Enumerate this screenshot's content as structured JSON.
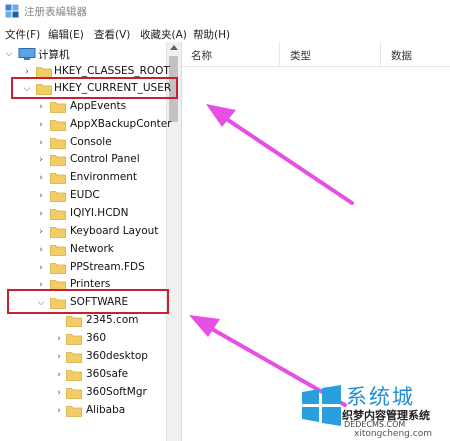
{
  "window": {
    "title": "注册表编辑器"
  },
  "menu": [
    "文件(F)",
    "编辑(E)",
    "查看(V)",
    "收藏夹(A)",
    "帮助(H)"
  ],
  "tree": {
    "root": "计算机",
    "hkcr": "HKEY_CLASSES_ROOT",
    "hkcu": "HKEY_CURRENT_USER",
    "hkcu_children": [
      "AppEvents",
      "AppXBackupConter",
      "Console",
      "Control Panel",
      "Environment",
      "EUDC",
      "IQIYI.HCDN",
      "Keyboard Layout",
      "Network",
      "PPStream.FDS",
      "Printers",
      "SOFTWARE"
    ],
    "software_children": [
      "2345.com",
      "360",
      "360desktop",
      "360safe",
      "360SoftMgr",
      "Alibaba"
    ]
  },
  "list_columns": [
    "名称",
    "类型",
    "数据"
  ],
  "watermark": {
    "brand": "系统城",
    "tagline": "织梦内容管理系统",
    "url1": "DEDECMS.COM",
    "url2": "xitongcheng.com"
  },
  "colors": {
    "highlight": "#cc1f2e",
    "arrow": "#e64ee6",
    "folder": "#f2cc65"
  }
}
